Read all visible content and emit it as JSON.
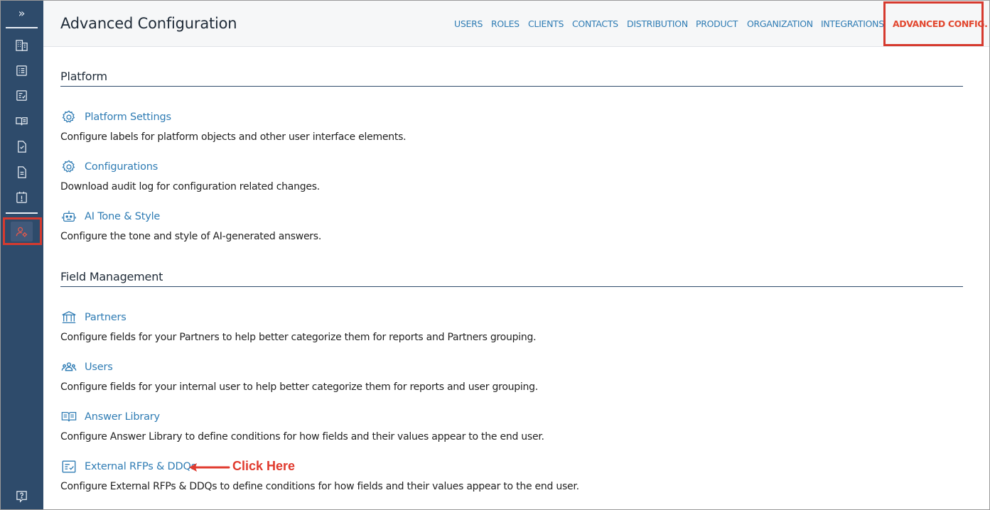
{
  "page": {
    "title": "Advanced Configuration"
  },
  "nav": {
    "items": [
      {
        "label": "USERS"
      },
      {
        "label": "ROLES"
      },
      {
        "label": "CLIENTS"
      },
      {
        "label": "CONTACTS"
      },
      {
        "label": "DISTRIBUTION"
      },
      {
        "label": "PRODUCT"
      },
      {
        "label": "ORGANIZATION"
      },
      {
        "label": "INTEGRATIONS"
      },
      {
        "label": "ADVANCED CONFIG.",
        "active": true
      }
    ]
  },
  "sidebar": {
    "toggle": "»",
    "items": [
      {
        "icon": "building-icon"
      },
      {
        "icon": "list-icon"
      },
      {
        "icon": "checklist-icon"
      },
      {
        "icon": "book-icon"
      },
      {
        "icon": "document-check-icon"
      },
      {
        "icon": "document-icon"
      },
      {
        "icon": "alert-icon"
      },
      {
        "icon": "user-settings-icon",
        "active": true
      }
    ],
    "help_icon": "help-icon"
  },
  "sections": [
    {
      "title": "Platform",
      "items": [
        {
          "icon": "gear-icon",
          "label": "Platform Settings",
          "description": "Configure labels for platform objects and other user interface elements."
        },
        {
          "icon": "gear-icon",
          "label": "Configurations",
          "description": "Download audit log for configuration related changes."
        },
        {
          "icon": "robot-icon",
          "label": "AI Tone & Style",
          "description": "Configure the tone and style of AI-generated answers."
        }
      ]
    },
    {
      "title": "Field Management",
      "items": [
        {
          "icon": "bank-icon",
          "label": "Partners",
          "description": "Configure fields for your Partners to help better categorize them for reports and Partners grouping."
        },
        {
          "icon": "users-icon",
          "label": "Users",
          "description": "Configure fields for your internal user to help better categorize them for reports and user grouping."
        },
        {
          "icon": "book-icon",
          "label": "Answer Library",
          "description": "Configure Answer Library to define conditions for how fields and their values appear to the end user."
        },
        {
          "icon": "checklist-icon",
          "label": "External RFPs & DDQs",
          "description": "Configure External RFPs & DDQs to define conditions for how fields and their values appear to the end user."
        }
      ]
    }
  ],
  "annotation": {
    "text": "Click Here"
  },
  "colors": {
    "sidebar": "#2e4b6b",
    "link": "#2f7cb4",
    "active": "#e2472f",
    "highlight": "#d63a2f"
  }
}
